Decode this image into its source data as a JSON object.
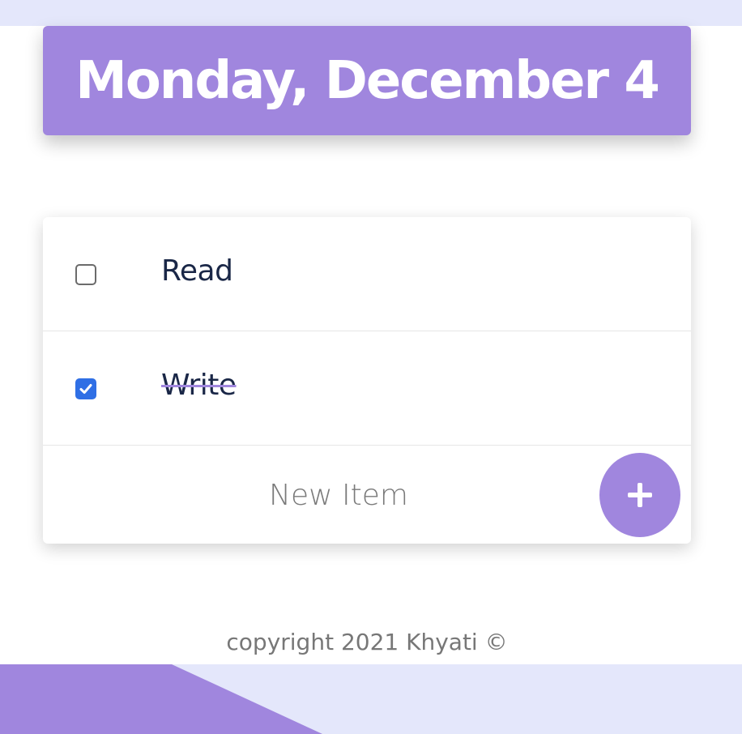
{
  "header": {
    "title": "Monday, December 4"
  },
  "todo": {
    "items": [
      {
        "label": "Read",
        "checked": false
      },
      {
        "label": "Write",
        "checked": true
      }
    ],
    "new_item_placeholder": "New Item",
    "add_button_icon": "plus-icon"
  },
  "footer": {
    "text": "copyright 2021 Khyati ©"
  },
  "colors": {
    "accent": "#a086de",
    "band": "#e4e7fb",
    "checkbox_checked": "#2f6fe5",
    "item_text": "#1a2747"
  }
}
